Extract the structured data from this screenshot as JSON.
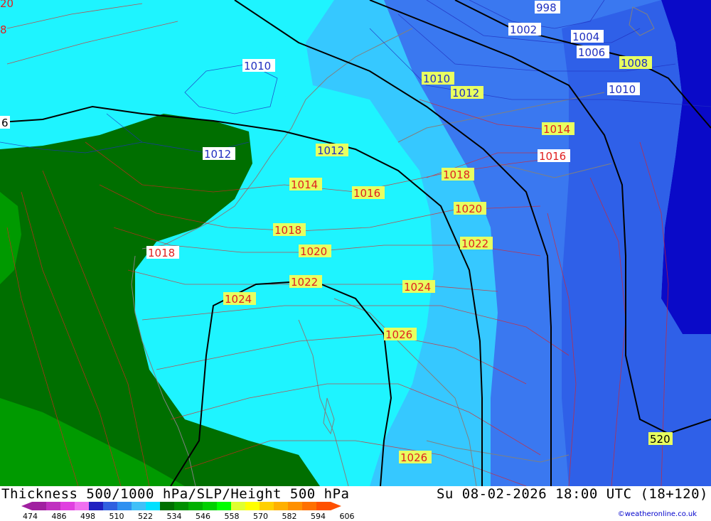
{
  "header": {
    "title": "Thickness 500/1000 hPa/SLP/Height 500 hPa",
    "timestamp": "Su 08-02-2026 18:00 UTC (18+120)"
  },
  "legend": {
    "ticks": [
      "474",
      "486",
      "498",
      "510",
      "522",
      "534",
      "546",
      "558",
      "570",
      "582",
      "594",
      "606"
    ],
    "colors": [
      "#a020a0",
      "#c030c0",
      "#e040e0",
      "#f070f0",
      "#2020c0",
      "#3060e0",
      "#3090f0",
      "#40c0f8",
      "#00e0ff",
      "#007000",
      "#009000",
      "#00b000",
      "#00d000",
      "#00ff00",
      "#e0ff30",
      "#ffff00",
      "#ffd000",
      "#ffb000",
      "#ff9000",
      "#ff7000",
      "#ff5000"
    ]
  },
  "credit": "©weatheronline.co.uk",
  "map": {
    "colors": {
      "deep_blue": "#0a0ac8",
      "blue": "#3a78f0",
      "light_blue": "#36c8ff",
      "cyan": "#1ef4ff",
      "dark_green": "#006f00",
      "green": "#009a00",
      "isobar_red": "#e02020",
      "isobar_blue": "#2030c0",
      "height_black": "#000000",
      "coast": "#808080"
    },
    "isobar_labels": [
      "998",
      "1002",
      "1004",
      "1006",
      "1008",
      "1010",
      "1010",
      "1010",
      "1012",
      "1012",
      "1012",
      "1014",
      "1014",
      "1016",
      "1016",
      "1018",
      "1018",
      "1018",
      "1020",
      "1020",
      "1022",
      "1022",
      "1024",
      "1024",
      "1026",
      "1026",
      "1020",
      "1018"
    ],
    "height_labels": [
      "520",
      "6",
      "20",
      "8"
    ]
  }
}
